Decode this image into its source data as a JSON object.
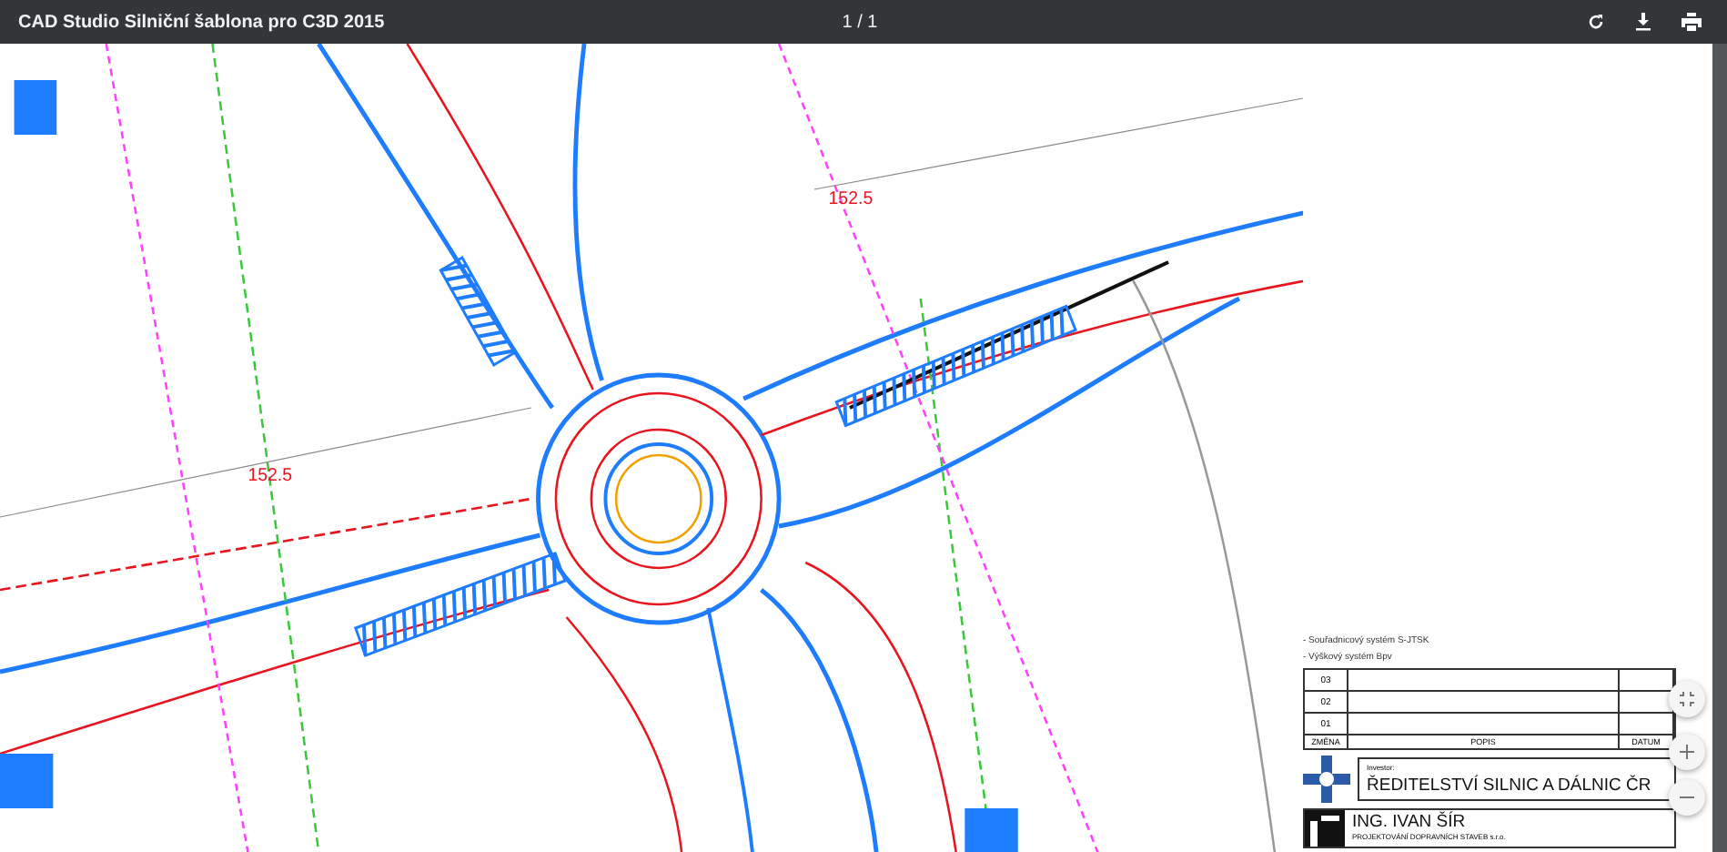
{
  "toolbar": {
    "title": "CAD Studio Silniční šablona pro C3D 2015",
    "page_indicator": "1 / 1"
  },
  "drawing_labels": [
    {
      "text": "152.5"
    },
    {
      "text": "152.5"
    }
  ],
  "title_block": {
    "notes": [
      "- Souřadnicový systém S-JTSK",
      "- Výškový systém Bpv"
    ],
    "revisions": [
      {
        "number": "03"
      },
      {
        "number": "02"
      },
      {
        "number": "01"
      }
    ],
    "revision_headers": [
      "ZMĚNA",
      "POPIS",
      "DATUM"
    ],
    "investor_label": "Investor:",
    "investor": "ŘEDITELSTVÍ SILNIC A DÁLNIC ČR",
    "designer": "ING. IVAN ŠÍR",
    "designer_company": "PROJEKTOVÁNÍ DOPRAVNÍCH STAVEB s.r.o."
  }
}
